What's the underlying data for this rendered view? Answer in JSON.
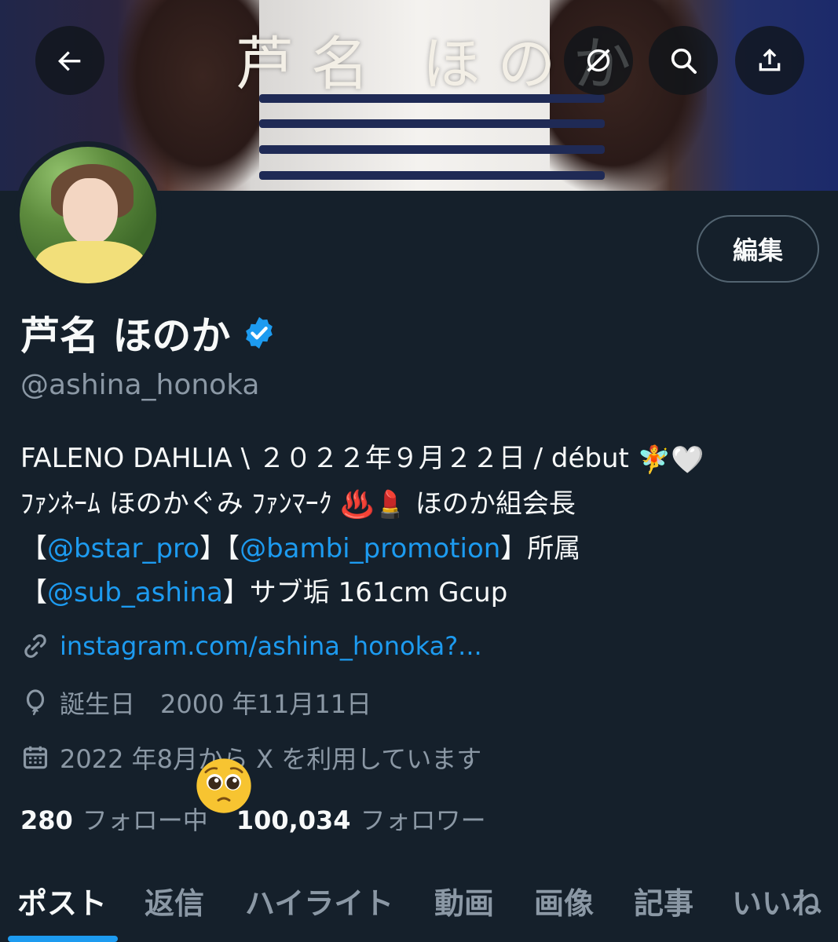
{
  "banner": {
    "caption": "芦名 ほのか"
  },
  "header": {
    "back_icon": "arrow-left-icon",
    "grok_icon": "grok-icon",
    "search_icon": "search-icon",
    "share_icon": "share-icon"
  },
  "profile": {
    "edit_label": "編集",
    "name": "芦名 ほのか",
    "handle": "@ashina_honoka",
    "bio": {
      "line1_text": "FALENO DAHLIA \\ ２０２２年９月２２日 / début ",
      "line1_emoji": "🧚🤍",
      "line2_text_a": "ﾌｧﾝﾈｰﾑ ほのかぐみ ﾌｧﾝﾏｰｸ ",
      "line2_emoji": "♨️💄",
      "line2_text_b": "  ほのか組会長",
      "line3_open": "【",
      "line3_mention1": "@bstar_pro",
      "line3_mid": "】【",
      "line3_mention2": "@bambi_promotion",
      "line3_close": "】所属",
      "line4_open": "【",
      "line4_mention": "@sub_ashina",
      "line4_rest": "】サブ垢 161cm Gcup"
    },
    "website": "instagram.com/ashina_honoka?...",
    "birthday": "誕生日　2000 年11月11日",
    "joined": "2022 年8月から X を利用しています",
    "following_count": "280",
    "following_label": "フォロー中",
    "followers_count": "100,034",
    "followers_label": "フォロワー",
    "overlay_emoji": "🥺"
  },
  "tabs": [
    {
      "label": "ポスト",
      "active": true
    },
    {
      "label": "返信"
    },
    {
      "label": "ハイライト"
    },
    {
      "label": "動画"
    },
    {
      "label": "画像"
    },
    {
      "label": "記事"
    },
    {
      "label": "いいね"
    }
  ],
  "colors": {
    "background": "#15202b",
    "accent": "#1d9bf0",
    "muted": "#8b98a5",
    "text": "#f7f9f9"
  }
}
